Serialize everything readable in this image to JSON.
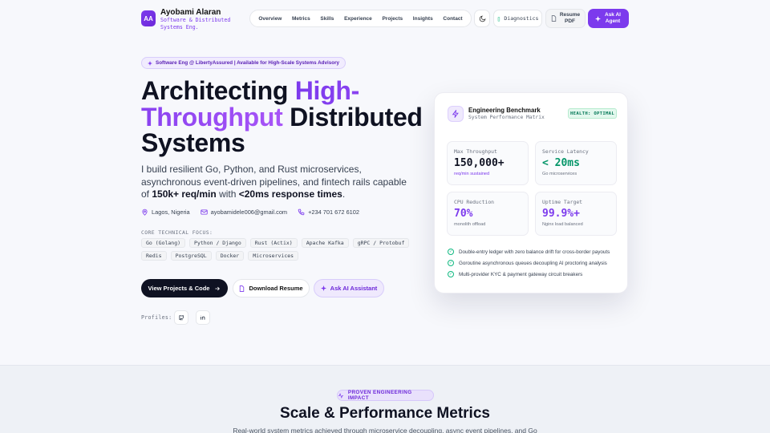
{
  "brand": {
    "initials": "AA",
    "name": "Ayobami Alaran",
    "tagline": "Software & Distributed Systems Eng."
  },
  "nav": [
    "Overview",
    "Metrics",
    "Skills",
    "Experience",
    "Projects",
    "Insights",
    "Contact"
  ],
  "header": {
    "diagnostics": "Diagnostics",
    "resume": "Resume PDF",
    "agent": "Ask AI Agent"
  },
  "hero": {
    "badge": "Software Eng @ LibertyAssured | Available for High-Scale Systems Advisory",
    "title_a": "Architecting ",
    "title_b": "High-Throughput",
    "title_c": " Distributed Systems",
    "lead_a": "I build resilient Go, Python, and Rust microservices, asynchronous event-driven pipelines, and fintech rails capable of ",
    "lead_b": "150k+ req/min",
    "lead_c": " with ",
    "lead_d": "<20ms response times",
    "lead_e": ".",
    "location": "Lagos, Nigeria",
    "email": "ayobamidele006@gmail.com",
    "phone": "+234 701 672 6102",
    "focus_label": "CORE TECHNICAL FOCUS:",
    "skills": [
      "Go (Golang)",
      "Python / Django",
      "Rust (Actix)",
      "Apache Kafka",
      "gRPC / Protobuf",
      "Redis",
      "PostgreSQL",
      "Docker",
      "Microservices"
    ],
    "btn_projects": "View Projects & Code",
    "btn_resume": "Download Resume",
    "btn_ai": "Ask AI Assistant",
    "profiles_label": "Profiles:"
  },
  "bench": {
    "title": "Engineering Benchmark",
    "subtitle": "System Performance Matrix",
    "health": "HEALTH: OPTIMAL",
    "metrics": [
      {
        "label": "Max Throughput",
        "value": "150,000+",
        "sub": "req/min sustained"
      },
      {
        "label": "Service Latency",
        "value": "< 20ms",
        "sub": "Go microservices"
      },
      {
        "label": "CPU Reduction",
        "value": "70%",
        "sub": "monolith offload"
      },
      {
        "label": "Uptime Target",
        "value": "99.9%+",
        "sub": "Nginx load balanced"
      }
    ],
    "checks": [
      "Double-entry ledger with zero balance drift for cross-border payouts",
      "Goroutine asynchronous queues decoupling AI proctoring analysis",
      "Multi-provider KYC & payment gateway circuit breakers"
    ]
  },
  "section": {
    "badge": "PROVEN ENGINEERING IMPACT",
    "title": "Scale & Performance Metrics",
    "desc": "Real-world system metrics achieved through microservice decoupling, async event pipelines, and Go"
  },
  "colors": {
    "accent": "#7c3aed",
    "green": "#059669",
    "dark": "#0f1222"
  }
}
